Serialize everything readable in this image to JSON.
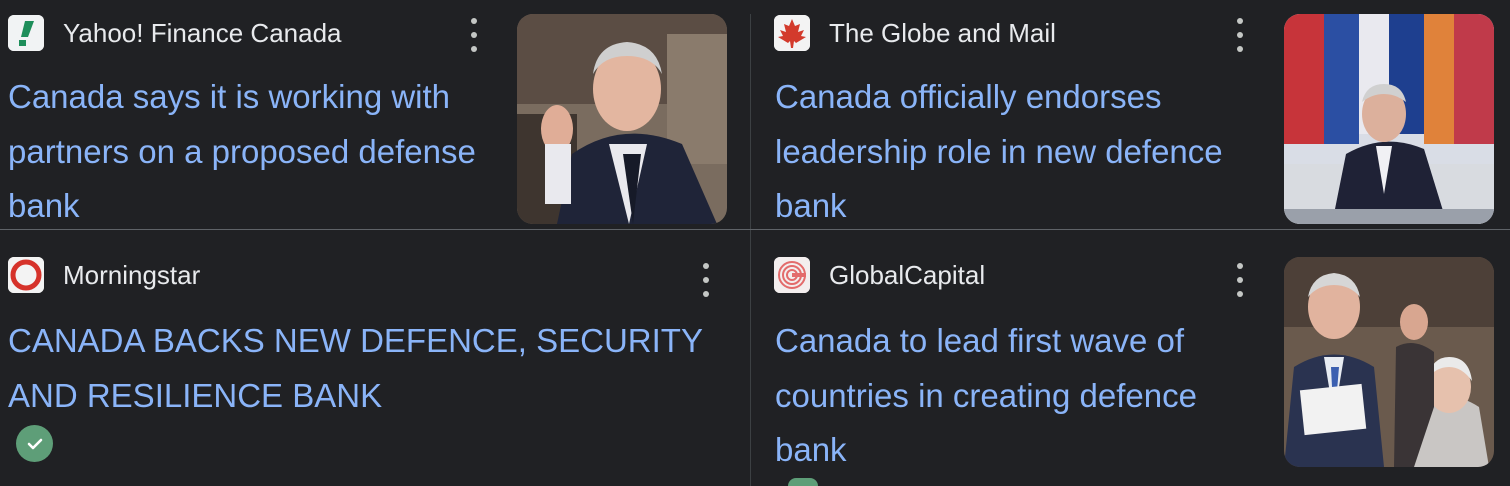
{
  "cards": [
    {
      "source": "Yahoo! Finance Canada",
      "logo_icon": "yahoo-finance-logo",
      "title": "Canada says it is working with partners on a proposed defense bank",
      "menu_icon": "more-vert-icon"
    },
    {
      "source": "The Globe and Mail",
      "logo_icon": "maple-leaf-logo",
      "title": "Canada officially endorses leadership role in new defence bank",
      "menu_icon": "more-vert-icon"
    },
    {
      "source": "Morningstar",
      "logo_icon": "morningstar-logo",
      "title": "CANADA BACKS NEW DEFENCE, SECURITY AND RESILIENCE BANK",
      "badge_icon": "verified-check-icon",
      "menu_icon": "more-vert-icon"
    },
    {
      "source": "GlobalCapital",
      "logo_icon": "globalcapital-logo",
      "title": "Canada to lead first wave of countries in creating defence bank",
      "menu_icon": "more-vert-icon"
    }
  ],
  "colors": {
    "background": "#202124",
    "title_link": "#8ab4f8",
    "source_text": "#e8eaed",
    "divider": "#5f6368",
    "verified": "#5e9e78"
  }
}
